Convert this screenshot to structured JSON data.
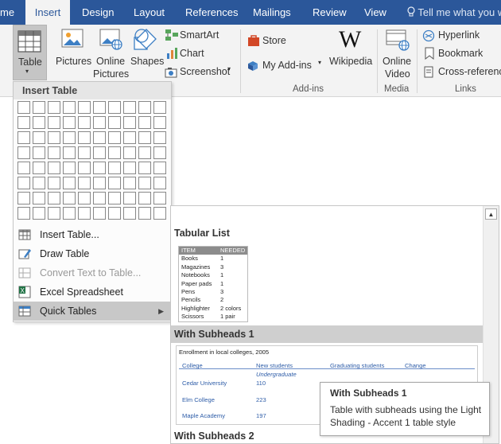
{
  "ribbon_tabs": [
    {
      "label": "me"
    },
    {
      "label": "Insert"
    },
    {
      "label": "Design"
    },
    {
      "label": "Layout"
    },
    {
      "label": "References"
    },
    {
      "label": "Mailings"
    },
    {
      "label": "Review"
    },
    {
      "label": "View"
    }
  ],
  "tell_me": "Tell me what you w",
  "ribbon": {
    "table": "Table",
    "pictures": "Pictures",
    "online_pictures_1": "Online",
    "online_pictures_2": "Pictures",
    "shapes": "Shapes",
    "smartart": "SmartArt",
    "chart": "Chart",
    "screenshot": "Screenshot",
    "store": "Store",
    "my_addins": "My Add-ins",
    "wikipedia": "Wikipedia",
    "online_video_1": "Online",
    "online_video_2": "Video",
    "hyperlink": "Hyperlink",
    "bookmark": "Bookmark",
    "cross_reference": "Cross-reference",
    "group_addins": "Add-ins",
    "group_media": "Media",
    "group_links": "Links"
  },
  "table_menu": {
    "header": "Insert Table",
    "grid_cols": 10,
    "grid_rows": 8,
    "items": [
      {
        "label": "Insert Table...",
        "disabled": false
      },
      {
        "label": "Draw Table",
        "disabled": false
      },
      {
        "label": "Convert Text to Table...",
        "disabled": true
      },
      {
        "label": "Excel Spreadsheet",
        "disabled": false
      },
      {
        "label": "Quick Tables",
        "disabled": false
      }
    ]
  },
  "gallery": {
    "tabular_list": {
      "title": "Tabular List",
      "col1": "ITEM",
      "col2": "NEEDED",
      "rows": [
        [
          "Books",
          "1"
        ],
        [
          "Magazines",
          "3"
        ],
        [
          "Notebooks",
          "1"
        ],
        [
          "Paper pads",
          "1"
        ],
        [
          "Pens",
          "3"
        ],
        [
          "Pencils",
          "2"
        ],
        [
          "Highlighter",
          "2 colors"
        ],
        [
          "Scissors",
          "1 pair"
        ]
      ]
    },
    "with_subheads_1": {
      "title": "With Subheads 1",
      "caption": "Enrollment in local colleges, 2005",
      "headers": [
        "College",
        "New students",
        "Graduating students",
        "Change"
      ],
      "subhead": "Undergraduate",
      "rows": [
        [
          "Cedar University",
          "110"
        ],
        [
          "Elm College",
          "223"
        ],
        [
          "Maple Academy",
          "197"
        ]
      ]
    },
    "with_subheads_2": {
      "title": "With Subheads 2"
    }
  },
  "tooltip": {
    "title": "With Subheads 1",
    "body": "Table with subheads using the Light Shading - Accent 1  table style"
  }
}
